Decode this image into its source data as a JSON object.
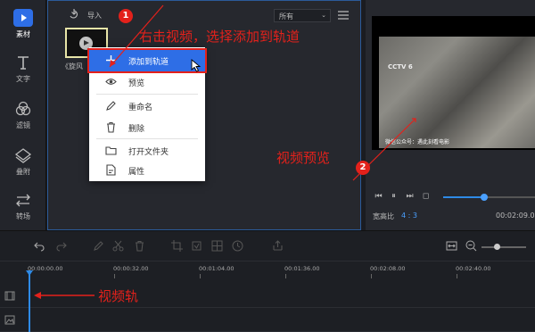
{
  "rail": {
    "items": [
      {
        "label": "素材",
        "icon": "media-icon"
      },
      {
        "label": "文字",
        "icon": "text-icon"
      },
      {
        "label": "滤镜",
        "icon": "filter-icon"
      },
      {
        "label": "叠附",
        "icon": "overlay-icon"
      },
      {
        "label": "转场",
        "icon": "transition-icon"
      }
    ]
  },
  "media": {
    "import_label": "导入",
    "filter_value": "所有",
    "thumb_label": "《旋风",
    "context_menu": [
      {
        "label": "添加到轨道",
        "icon": "plus-icon"
      },
      {
        "label": "预览",
        "icon": "eye-icon"
      },
      {
        "label": "重命名",
        "icon": "pencil-icon"
      },
      {
        "label": "删除",
        "icon": "trash-icon"
      },
      {
        "label": "打开文件夹",
        "icon": "folder-icon"
      },
      {
        "label": "属性",
        "icon": "properties-icon"
      }
    ]
  },
  "preview": {
    "watermark": "CCTV 6",
    "caption": "微信公众号：遇此刻看电影",
    "ratio_label": "宽高比",
    "ratio_value": "4 : 3",
    "time": "00:02:09.02",
    "progress": 0.45
  },
  "timeline": {
    "ticks": [
      "00:00:00.00",
      "00:00:32.00",
      "00:01:04.00",
      "00:01:36.00",
      "00:02:08.00",
      "00:02:40.00"
    ],
    "zoom": 0.35
  },
  "annotations": {
    "one": "1",
    "two": "2",
    "step1": "右击视频，选择添加到轨道",
    "step2": "视频预览",
    "track": "视频轨"
  },
  "colors": {
    "accent": "#2e6ee6",
    "annotation": "#e3211b"
  }
}
